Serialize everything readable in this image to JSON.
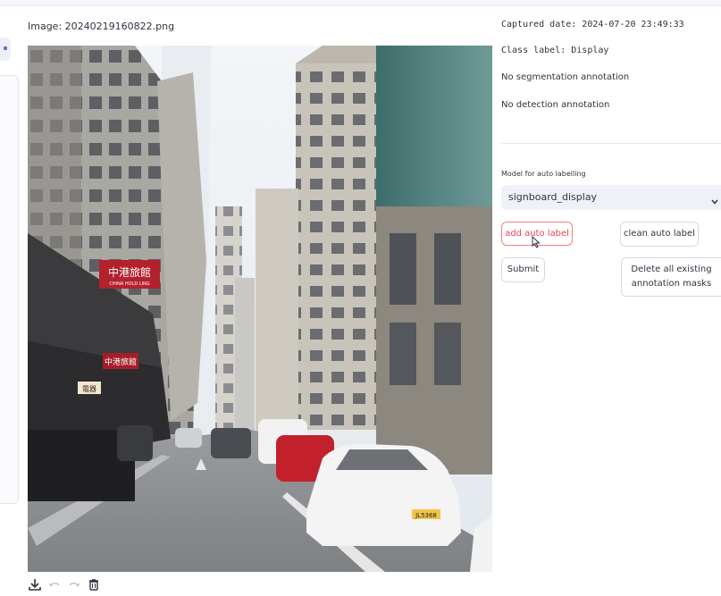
{
  "image_caption": "Image: 20240219160822.png",
  "info": {
    "captured_date": "Captured date: 2024-07-20 23:49:33",
    "class_label": "Class label: Display",
    "segmentation": "No segmentation annotation",
    "detection": "No detection annotation"
  },
  "auto_label": {
    "model_label": "Model for auto labelling",
    "model_value": "signboard_display"
  },
  "buttons": {
    "add_auto_label": "add auto label",
    "clean_auto_label": "clean auto label",
    "submit": "Submit",
    "delete_masks": "Delete all existing annotation masks"
  },
  "photo_signs": {
    "sign_1_main": "中港旅館",
    "sign_1_sub": "CHINA HOLD LING",
    "sign_2": "中港旅館",
    "sign_3": "電器",
    "plate": "JL5368"
  },
  "icons": {
    "download": "download-icon",
    "undo": "undo-icon",
    "redo": "redo-icon",
    "delete": "trash-icon",
    "dropdown": "chevron-down-icon",
    "cursor": "mouse-pointer-icon"
  },
  "colors": {
    "accent_red": "#e8474d",
    "select_bg": "#eef1f8",
    "text": "#31333f"
  }
}
